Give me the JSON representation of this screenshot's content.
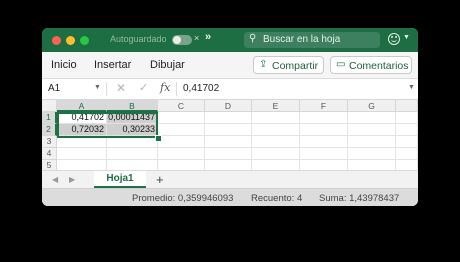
{
  "titlebar": {
    "autosave_label": "Autoguardado",
    "autosave_state": "off",
    "search_placeholder": "Buscar en la hoja"
  },
  "ribbon": {
    "tabs": [
      "Inicio",
      "Insertar",
      "Dibujar"
    ],
    "share_label": "Compartir",
    "comments_label": "Comentarios"
  },
  "formula_bar": {
    "name_box": "A1",
    "fx_label": "fx",
    "value": "0,41702"
  },
  "grid": {
    "columns": [
      "A",
      "B",
      "C",
      "D",
      "E",
      "F",
      "G"
    ],
    "rows": [
      "1",
      "2",
      "3",
      "4",
      "5"
    ],
    "cells": [
      [
        "0,41702",
        "0,00011437"
      ],
      [
        "0,72032",
        "0,30233"
      ]
    ]
  },
  "sheets": {
    "tabs": [
      "Hoja1"
    ],
    "add_label": "+"
  },
  "status": {
    "average": "Promedio: 0,359946093",
    "count": "Recuento: 4",
    "sum": "Suma: 1,43978437"
  },
  "colors": {
    "titlebar": "#1e6e43",
    "accent": "#1e7145",
    "selection": "#cfcfcf"
  }
}
